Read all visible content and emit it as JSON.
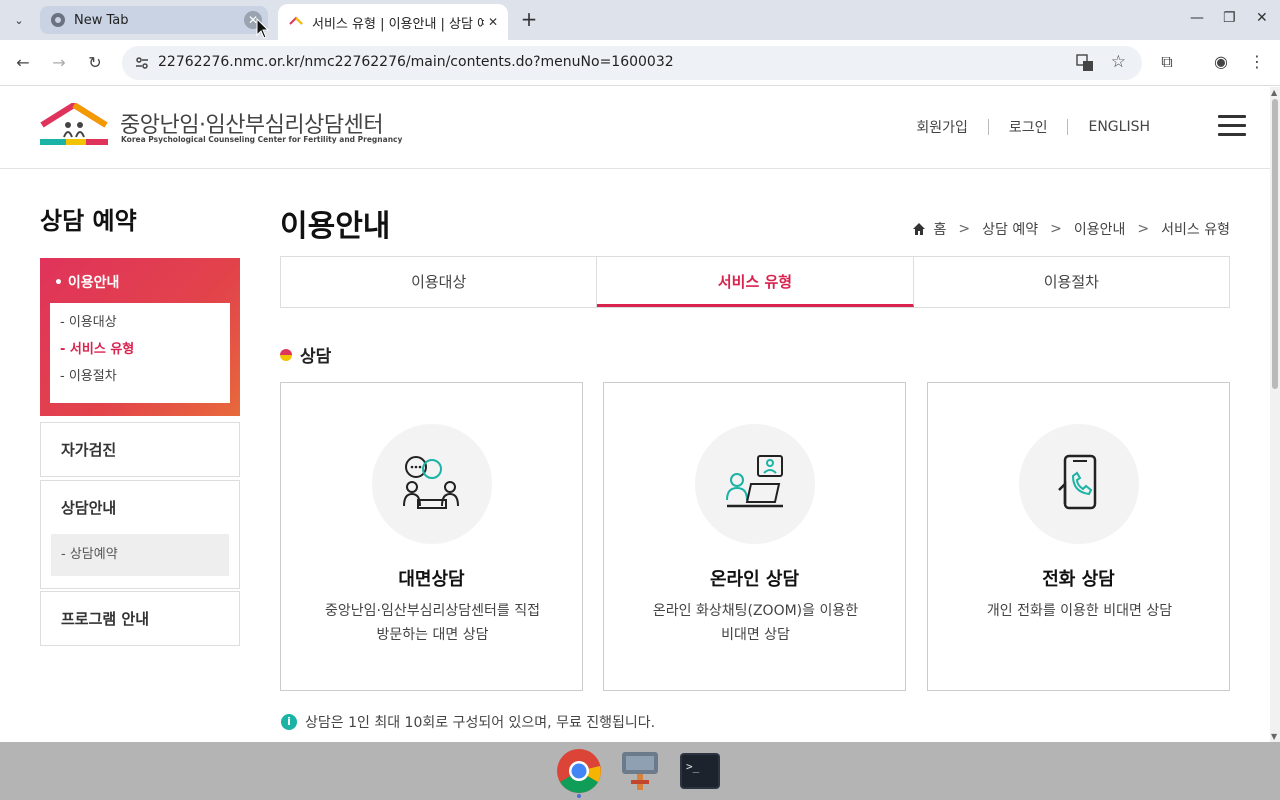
{
  "browser": {
    "tabs": [
      {
        "title": "New Tab",
        "active": false
      },
      {
        "title": "서비스 유형 | 이용안내 | 상담 예약",
        "active": true
      }
    ],
    "url": "22762276.nmc.or.kr/nmc22762276/main/contents.do?menuNo=1600032"
  },
  "header": {
    "logo_kr": "중앙난임·임산부심리상담센터",
    "logo_en": "Korea Psychological Counseling Center for Fertility and Pregnancy",
    "links": [
      "회원가입",
      "로그인",
      "ENGLISH"
    ]
  },
  "sidebar": {
    "title": "상담 예약",
    "active_group": "이용안내",
    "active_items": [
      {
        "label": "이용대상",
        "selected": false
      },
      {
        "label": "서비스 유형",
        "selected": true
      },
      {
        "label": "이용절차",
        "selected": false
      }
    ],
    "groups": [
      {
        "label": "자가검진",
        "items": []
      },
      {
        "label": "상담안내",
        "items": [
          "상담예약"
        ]
      },
      {
        "label": "프로그램 안내",
        "items": []
      }
    ]
  },
  "main": {
    "title": "이용안내",
    "breadcrumb": [
      "홈",
      "상담 예약",
      "이용안내",
      "서비스 유형"
    ],
    "tabs": [
      {
        "label": "이용대상",
        "active": false
      },
      {
        "label": "서비스 유형",
        "active": true
      },
      {
        "label": "이용절차",
        "active": false
      }
    ],
    "section_title": "상담",
    "cards": [
      {
        "title": "대면상담",
        "desc_line1": "중앙난임·임산부심리상담센터를 직접",
        "desc_line2": "방문하는 대면 상담",
        "icon": "face-to-face-icon"
      },
      {
        "title": "온라인 상담",
        "desc_line1": "온라인 화상채팅(ZOOM)을 이용한",
        "desc_line2": "비대면 상담",
        "icon": "online-counseling-icon"
      },
      {
        "title": "전화 상담",
        "desc_line1": "개인 전화를 이용한 비대면 상담",
        "desc_line2": "",
        "icon": "phone-counseling-icon"
      }
    ],
    "note": "상담은 1인 최대 10회로 구성되어 있으며, 무료 진행됩니다."
  },
  "colors": {
    "accent": "#d9234f",
    "teal": "#1bb3a5"
  }
}
